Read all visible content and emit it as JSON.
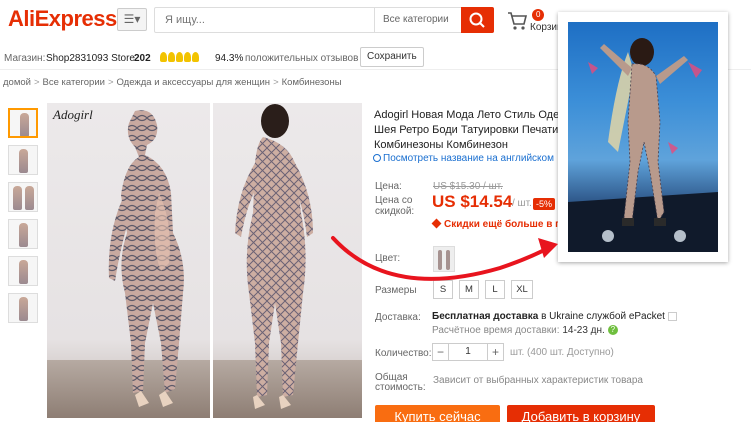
{
  "header": {
    "logo": "AliExpress",
    "search_placeholder": "Я ищу...",
    "search_category": "Все категории",
    "cart_count": "0",
    "cart_label": "Корзина"
  },
  "store": {
    "label": "Магазин:",
    "name": "Shop2831093 Store",
    "score": "202",
    "positive": "94.3%",
    "positive_label": "положительных отзывов",
    "save_label": "Сохранить"
  },
  "breadcrumb": [
    "домой",
    "Все категории",
    "Одежда и аксессуары для женщин",
    "Комбинезоны"
  ],
  "product": {
    "brand_watermark": "Adogirl",
    "title_lines": [
      "Adogirl Новая Мода Лето Стиль Одеж",
      "Шея Ретро Боди Татуировки Печати С",
      "Комбинезоны Комбинезон"
    ],
    "translate_link": "Посмотреть название на английском",
    "price_label": "Цена:",
    "old_price": "US $15.30 / шт.",
    "discount_price_label_1": "Цена со",
    "discount_price_label_2": "скидкой:",
    "price": "US $14.54",
    "price_unit": "/ шт.",
    "discount": "-5%",
    "promo": "Скидки ещё больше в прило",
    "color_label": "Цвет:",
    "size_label": "Размеры",
    "sizes": [
      "S",
      "M",
      "L",
      "XL"
    ],
    "shipping_label": "Доставка:",
    "shipping_bold": "Бесплатная доставка",
    "shipping_rest": "в Ukraine службой ePacket",
    "shipping_time_label": "Расчётное время доставки:",
    "shipping_time_value": "14-23 дн.",
    "qty_label": "Количество:",
    "qty_value": "1",
    "qty_minus": "−",
    "qty_plus": "+",
    "qty_note": "шт. (400 шт. Доступно)",
    "total_label_1": "Общая",
    "total_label_2": "стоимость:",
    "total_note": "Зависит от выбранных характеристик товара",
    "buy_now": "Купить сейчас",
    "add_to_cart": "Добавить в корзину"
  },
  "colors": {
    "brand": "#e62e04",
    "buy_button": "#f96d11",
    "link": "#1a6fd0",
    "arrow": "#e8141e"
  }
}
